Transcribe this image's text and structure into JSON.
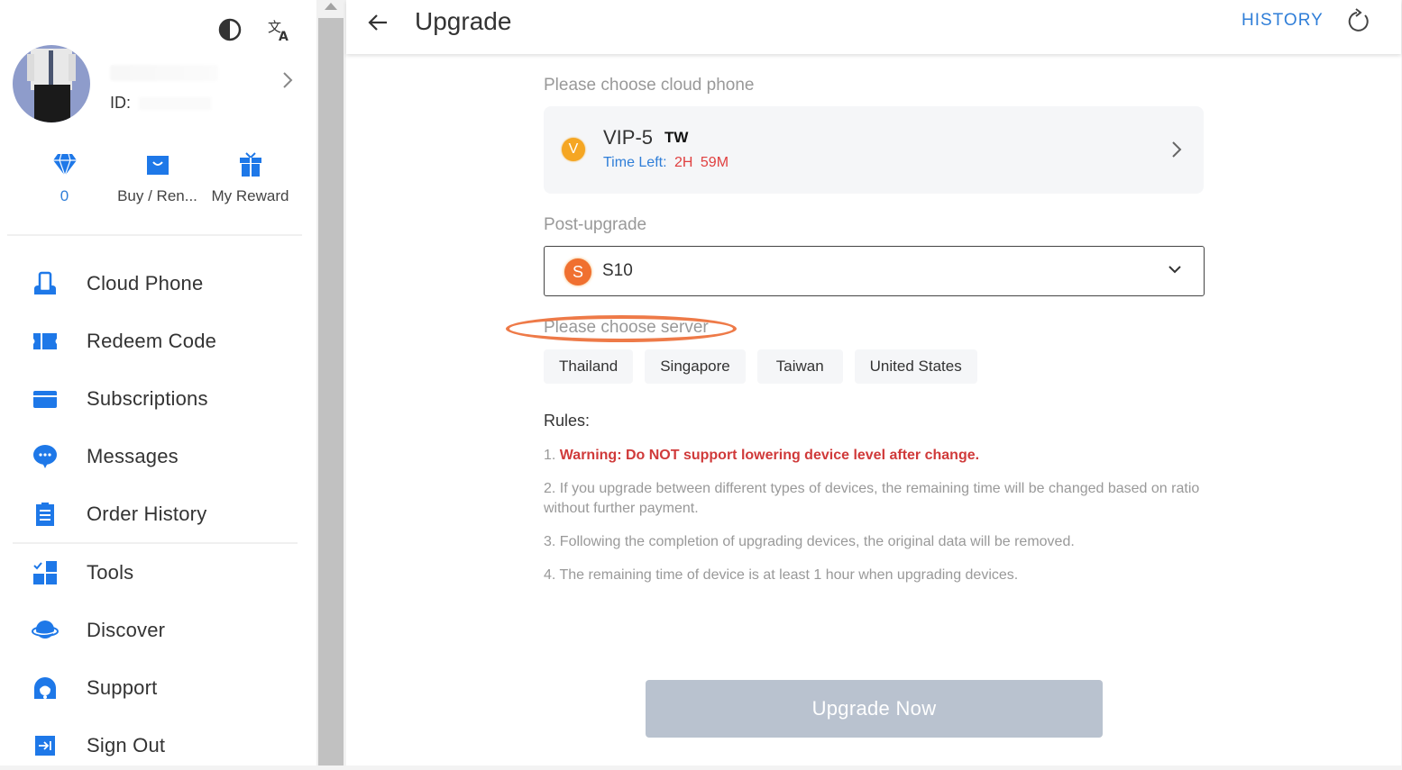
{
  "sidebar": {
    "top_icons": {
      "theme": "theme-toggle-icon",
      "language": "translate-icon"
    },
    "profile": {
      "id_label": "ID:"
    },
    "quick": [
      {
        "label": "0",
        "icon": "diamond-icon"
      },
      {
        "label": "Buy / Ren...",
        "icon": "shopping-bag-icon"
      },
      {
        "label": "My Reward",
        "icon": "gift-icon"
      }
    ],
    "nav": [
      {
        "label": "Cloud Phone",
        "icon": "cloud-phone-icon"
      },
      {
        "label": "Redeem Code",
        "icon": "ticket-icon"
      },
      {
        "label": "Subscriptions",
        "icon": "card-icon"
      },
      {
        "label": "Messages",
        "icon": "chat-icon"
      },
      {
        "label": "Order History",
        "icon": "clipboard-icon"
      },
      {
        "label": "Tools",
        "icon": "tools-grid-icon"
      },
      {
        "label": "Discover",
        "icon": "planet-icon"
      },
      {
        "label": "Support",
        "icon": "headset-icon"
      },
      {
        "label": "Sign Out",
        "icon": "sign-out-icon"
      }
    ]
  },
  "header": {
    "title": "Upgrade",
    "history_label": "HISTORY"
  },
  "main": {
    "choose_phone_label": "Please choose cloud phone",
    "phone": {
      "badge": "V",
      "name": "VIP-5",
      "region": "TW",
      "time_left_label": "Time Left:",
      "time_left_hours": "2H",
      "time_left_minutes": "59M"
    },
    "post_upgrade_label": "Post-upgrade",
    "post_upgrade": {
      "badge": "S",
      "value": "S10"
    },
    "choose_server_label": "Please choose server",
    "servers": [
      "Thailand",
      "Singapore",
      "Taiwan",
      "United States"
    ],
    "rules_title": "Rules:",
    "rules": [
      {
        "prefix": "1. ",
        "text": "Warning: Do NOT support lowering device level after change."
      },
      {
        "text": "2. If you upgrade between different types of devices, the remaining time will be changed based on ratio without further payment."
      },
      {
        "text": "3. Following the completion of upgrading devices, the original data will be removed."
      },
      {
        "text": "4. The remaining time of device is at least 1 hour when upgrading devices."
      }
    ],
    "upgrade_button": "Upgrade Now"
  },
  "colors": {
    "accent": "#2f7ed8",
    "warning": "#d03a3a",
    "highlight": "#ee7a48",
    "disabled_button": "#b9c2cf"
  }
}
